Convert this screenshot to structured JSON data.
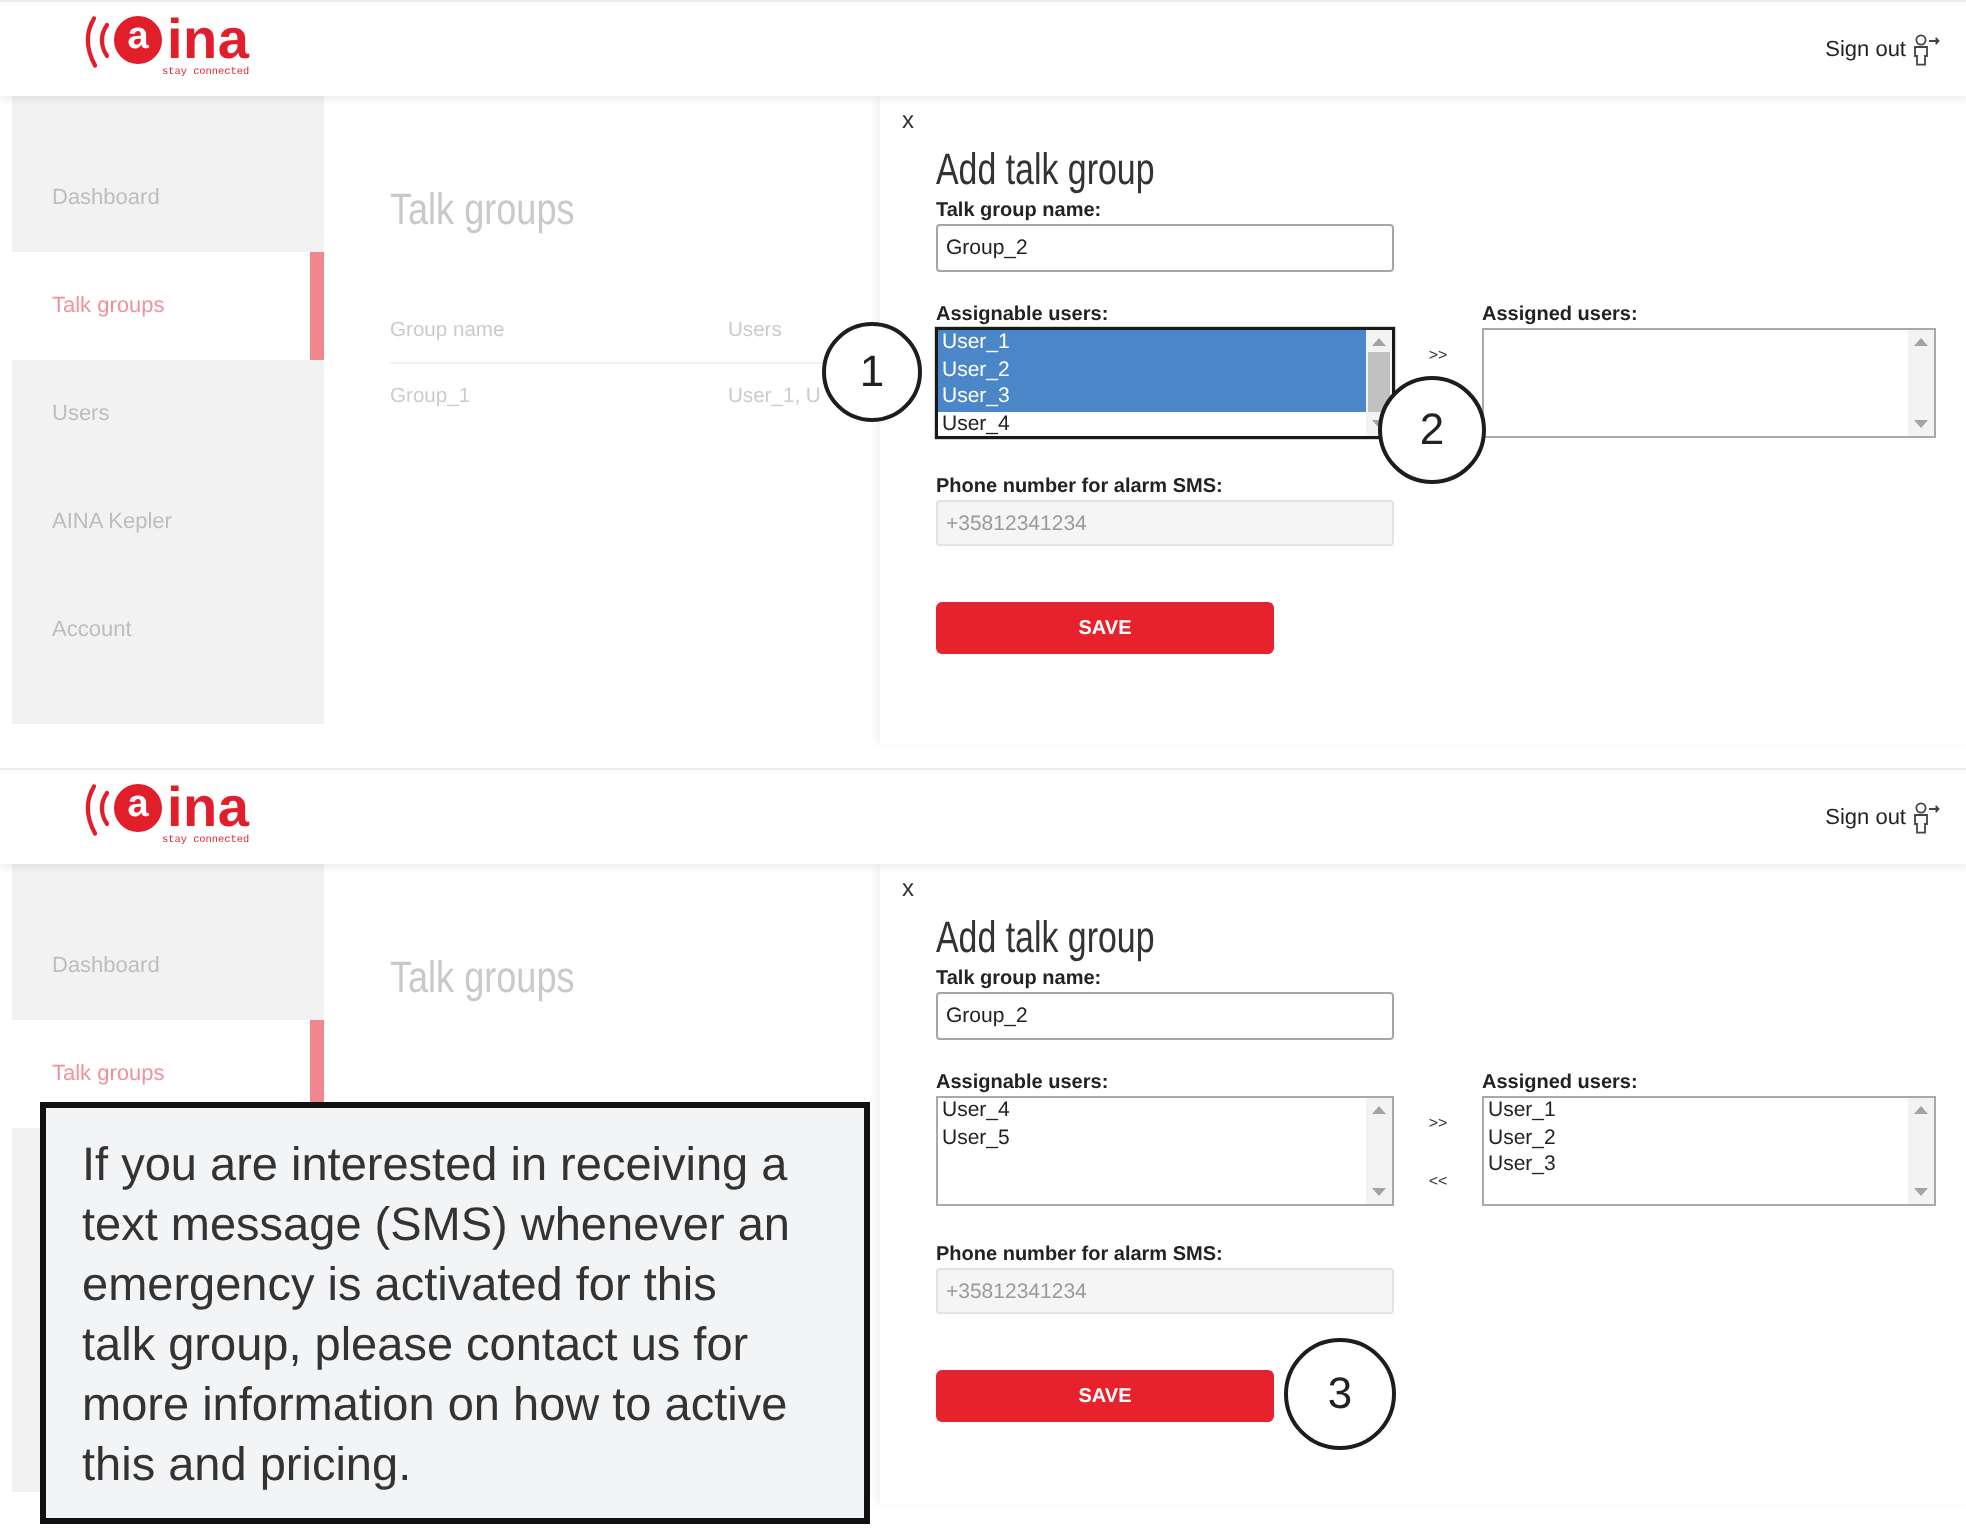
{
  "screens": [
    {
      "header": {
        "logo": {
          "mark": "a",
          "name": "ina",
          "tagline": "stay connected"
        },
        "sign_out": "Sign out"
      },
      "sidebar": {
        "items": [
          {
            "label": "Dashboard",
            "selected": false
          },
          {
            "label": "Talk groups",
            "selected": true
          },
          {
            "label": "Users",
            "selected": false
          },
          {
            "label": "AINA Kepler",
            "selected": false
          },
          {
            "label": "Account",
            "selected": false
          }
        ]
      },
      "page": {
        "title": "Talk groups",
        "table": {
          "columns": [
            "Group name",
            "Users"
          ],
          "rows": [
            [
              "Group_1",
              "User_1, U"
            ]
          ]
        }
      },
      "panel": {
        "close": "x",
        "title": "Add talk group",
        "name_field": {
          "label": "Talk group name:",
          "value": "Group_2"
        },
        "assignable": {
          "label": "Assignable users:",
          "focused": true,
          "callout": "1",
          "options": [
            {
              "label": "User_1",
              "selected": true
            },
            {
              "label": "User_2",
              "selected": true
            },
            {
              "label": "User_3",
              "selected": true
            },
            {
              "label": "User_4",
              "selected": false
            }
          ]
        },
        "move_buttons": [
          ">>"
        ],
        "move_callout": "2",
        "assigned": {
          "label": "Assigned users:",
          "focused": false
        },
        "phone_field": {
          "label": "Phone number for alarm SMS:",
          "placeholder": "+35812341234",
          "disabled": true
        },
        "save": {
          "label": "SAVE"
        }
      }
    },
    {
      "header": {
        "logo": {
          "mark": "a",
          "name": "ina",
          "tagline": "stay connected"
        },
        "sign_out": "Sign out"
      },
      "sidebar": {
        "items": [
          {
            "label": "Dashboard",
            "selected": false
          },
          {
            "label": "Talk groups",
            "selected": true
          }
        ]
      },
      "page": {
        "title": "Talk groups"
      },
      "panel": {
        "close": "x",
        "title": "Add talk group",
        "name_field": {
          "label": "Talk group name:",
          "value": "Group_2"
        },
        "assignable": {
          "label": "Assignable users:",
          "focused": false,
          "options": [
            {
              "label": "User_4",
              "selected": false
            },
            {
              "label": "User_5",
              "selected": false
            }
          ]
        },
        "move_buttons": [
          ">>",
          "<<"
        ],
        "assigned": {
          "label": "Assigned users:",
          "focused": false,
          "options": [
            {
              "label": "User_1",
              "selected": false
            },
            {
              "label": "User_2",
              "selected": false
            },
            {
              "label": "User_3",
              "selected": false
            }
          ]
        },
        "phone_field": {
          "label": "Phone number for alarm SMS:",
          "placeholder": "+35812341234",
          "disabled": true
        },
        "save": {
          "label": "SAVE",
          "callout": "3"
        }
      },
      "note": "If you are interested in receiving a text message (SMS) whenever an emergency is activated for this talk group, please contact us for more information on how to active this and pricing."
    }
  ]
}
